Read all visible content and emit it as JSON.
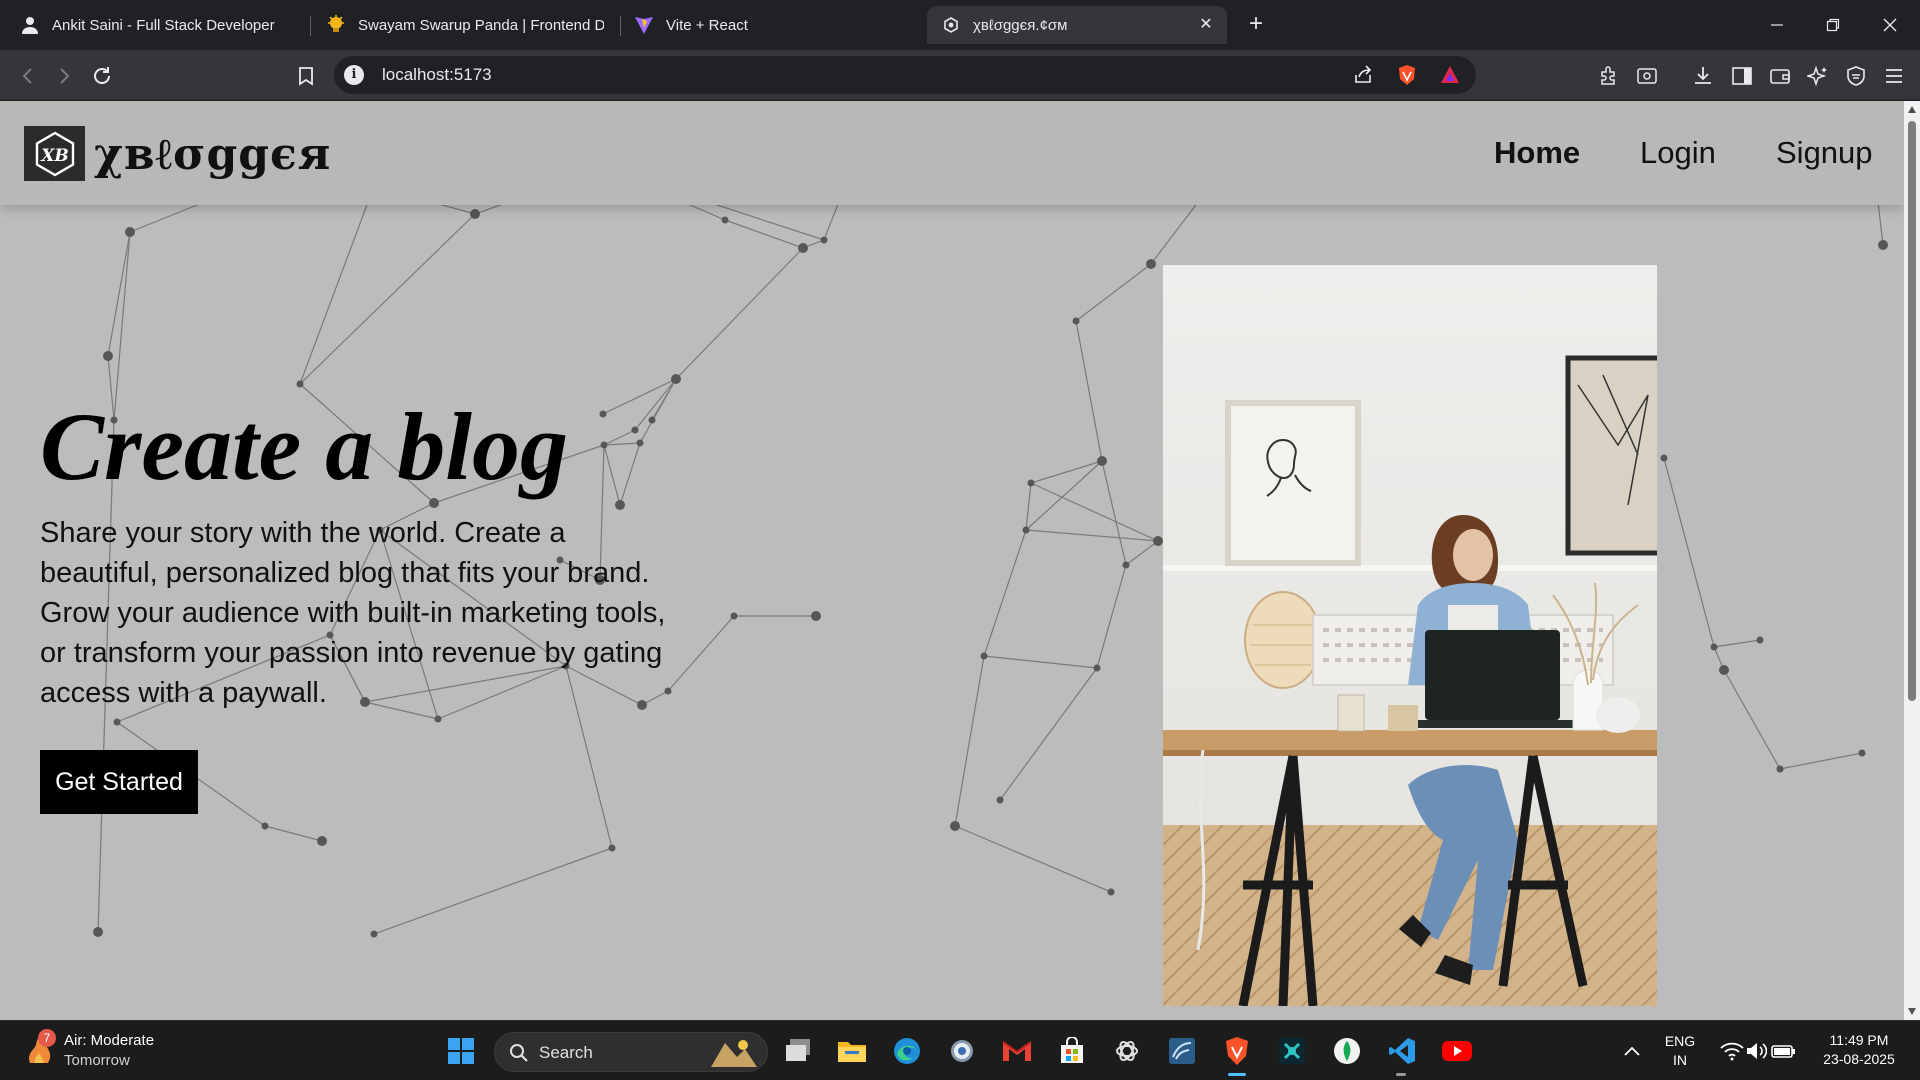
{
  "browser": {
    "tabs": [
      {
        "title": "Ankit Saini - Full Stack Developer",
        "icon": "person-icon"
      },
      {
        "title": "Swayam Swarup Panda | Frontend De",
        "icon": "lightbulb-icon"
      },
      {
        "title": "Vite + React",
        "icon": "vite-icon"
      },
      {
        "title": "χʙℓσggєя.¢σм",
        "icon": "xblogger-icon",
        "active": true
      }
    ],
    "address": "localhost:5173"
  },
  "site": {
    "logo_mark": "XB",
    "logo_text": "χʙℓσggєя",
    "nav": {
      "home": "Home",
      "login": "Login",
      "signup": "Signup"
    },
    "hero": {
      "title": "Create a blog",
      "text": "Share your story with the world. Create a beautiful, personalized blog that fits your brand. Grow your audience with built-in marketing tools, or transform your passion into revenue by gating access with a paywall.",
      "cta": "Get Started"
    },
    "image_alt": "Woman working on a laptop at a wooden desk"
  },
  "taskbar": {
    "weather": {
      "title": "Air: Moderate",
      "subtitle": "Tomorrow",
      "badge": "7"
    },
    "search_label": "Search",
    "language": {
      "line1": "ENG",
      "line2": "IN"
    },
    "clock": {
      "time": "11:49 PM",
      "date": "23-08-2025"
    }
  },
  "colors": {
    "page_bg": "#bcbcbc",
    "header_bg": "#b8b8b6",
    "cta_bg": "#000000",
    "taskbar_bg": "#1c1c1c",
    "accent": "#4cc2ff"
  }
}
